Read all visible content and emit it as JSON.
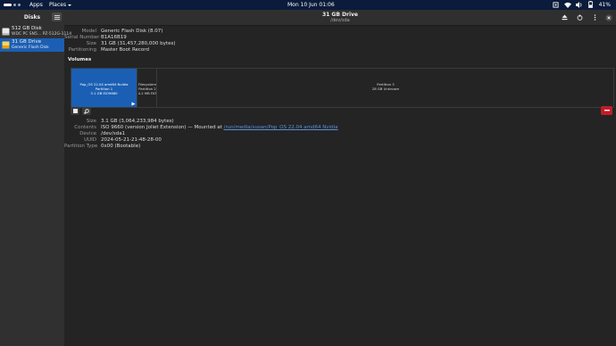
{
  "topbar": {
    "apps": "Apps",
    "places": "Places",
    "clock": "Mon 10 Jun  01:06",
    "battery": "41%"
  },
  "sidebar": {
    "title": "Disks",
    "items": [
      {
        "name": "512 GB Disk",
        "sub": "WDC PC SN5... PZ-512G-1114"
      },
      {
        "name": "31 GB Drive",
        "sub": "Generic Flash Disk"
      }
    ]
  },
  "header": {
    "title": "31 GB Drive",
    "subtitle": "/dev/sda"
  },
  "drive_info": {
    "model_label": "Model",
    "model": "Generic Flash Disk (8.07)",
    "serial_label": "Serial Number",
    "serial": "B1A16B19",
    "size_label": "Size",
    "size": "31 GB (31,457,280,000 bytes)",
    "partitioning_label": "Partitioning",
    "partitioning": "Master Boot Record"
  },
  "volumes_title": "Volumes",
  "partitions": [
    {
      "line1": "Pop_OS 22.04 amd64 Nvidia",
      "line2": "Partition 1",
      "line3": "3.1 GB ISO9660"
    },
    {
      "line1": "Filesystem",
      "line2": "Partition 2",
      "line3": "4.2 MB FAT"
    },
    {
      "line1": "Partition 3",
      "line2": "28 GB Unknown",
      "line3": ""
    }
  ],
  "volume_info": {
    "size_label": "Size",
    "size": "3.1 GB (3,064,233,984 bytes)",
    "contents_label": "Contents",
    "contents": "ISO 9660 (version Joliet Extension) — Mounted at ",
    "mount_link": "/run/media/susan/Pop_OS 22.04 amd64 Nvidia",
    "device_label": "Device",
    "device": "/dev/sda1",
    "uuid_label": "UUID",
    "uuid": "2024-05-21-21-48-28-00",
    "ptype_label": "Partition Type",
    "ptype": "0x00 (Bootable)"
  },
  "colors": {
    "accent": "#1b5fb4",
    "danger": "#c01c28",
    "topbar": "#0b1b3b"
  }
}
